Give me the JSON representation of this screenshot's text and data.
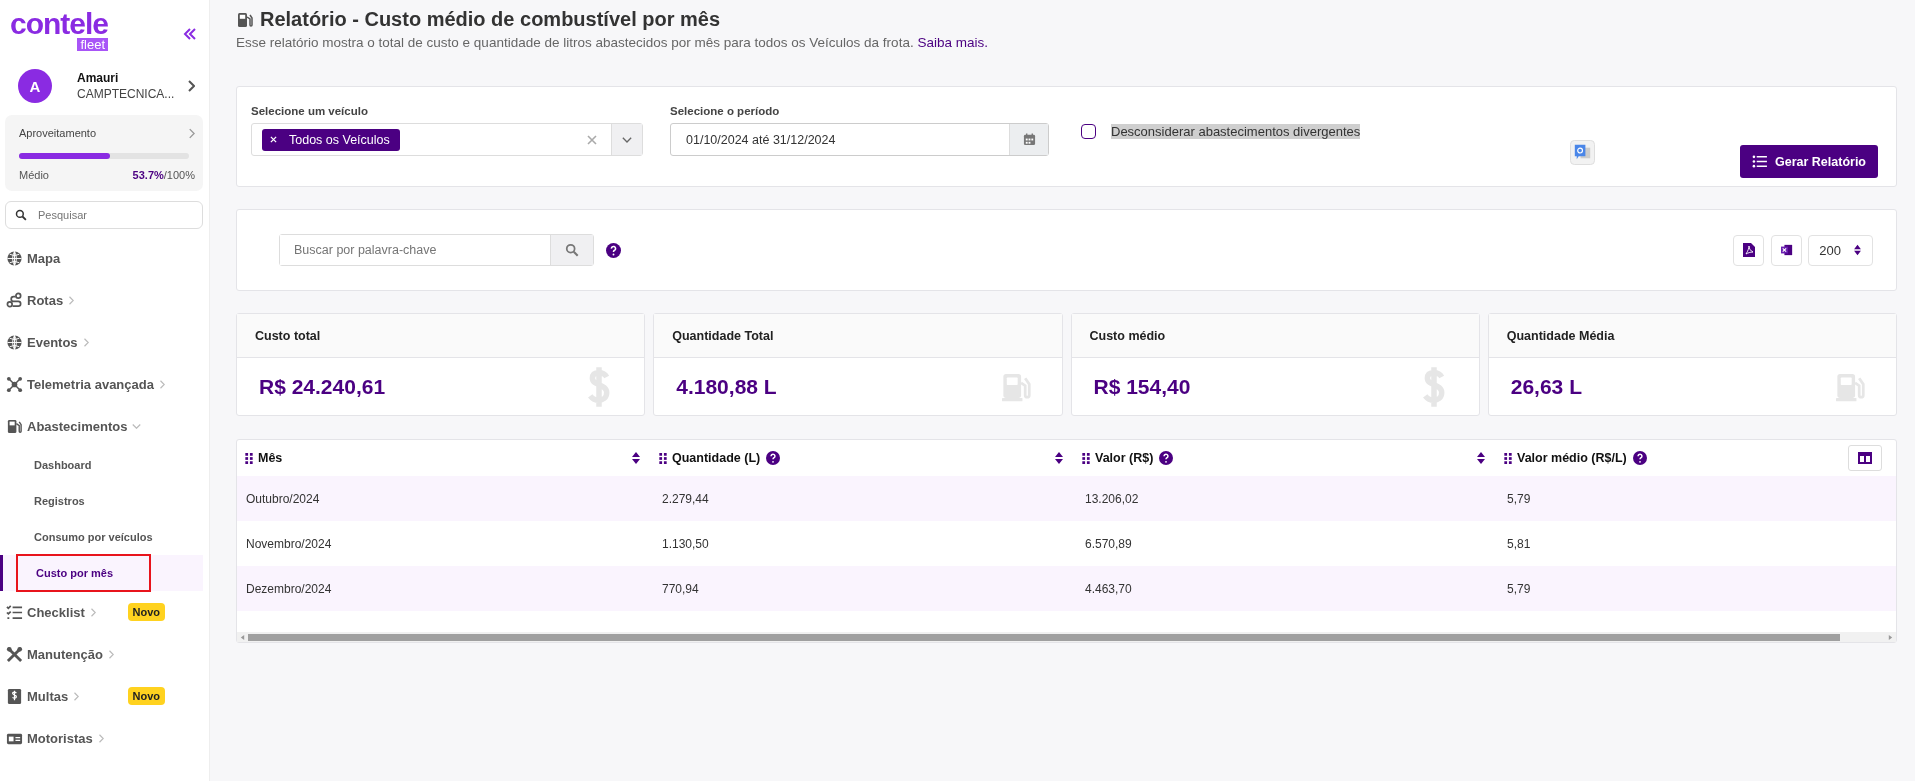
{
  "sidebar": {
    "logo": {
      "text": "contele",
      "badge": "fleet"
    },
    "user": {
      "initial": "A",
      "name": "Amauri",
      "company": "CAMPTECNICA..."
    },
    "usage": {
      "label": "Aproveitamento",
      "level": 0.537,
      "rating": "Médio",
      "value": "53.7%",
      "total": "/100%"
    },
    "search": {
      "placeholder": "Pesquisar"
    },
    "items": [
      {
        "label": "Mapa"
      },
      {
        "label": "Rotas",
        "expanded": false
      },
      {
        "label": "Eventos",
        "expanded": false
      },
      {
        "label": "Telemetria avançada",
        "expanded": false
      },
      {
        "label": "Abastecimentos",
        "expanded": true,
        "children": [
          {
            "label": "Dashboard",
            "selected": false,
            "highlighted": false
          },
          {
            "label": "Registros",
            "selected": false,
            "highlighted": false
          },
          {
            "label": "Consumo por veículos",
            "selected": false,
            "highlighted": false
          },
          {
            "label": "Custo por mês",
            "selected": true,
            "highlighted": true
          }
        ]
      },
      {
        "label": "Checklist",
        "expanded": false,
        "badge": "Novo"
      },
      {
        "label": "Manutenção",
        "expanded": false
      },
      {
        "label": "Multas",
        "expanded": false,
        "badge": "Novo"
      },
      {
        "label": "Motoristas",
        "expanded": false
      }
    ]
  },
  "header": {
    "title": "Relatório - Custo médio de combustível por mês",
    "description": "Esse relatório mostra o total de custo e quantidade de litros abastecidos por mês para todos os Veículos da frota.",
    "link": "Saiba mais."
  },
  "filters": {
    "vehicle": {
      "label": "Selecione um veículo",
      "chips": [
        "Todos os Veículos"
      ]
    },
    "period": {
      "label": "Selecione o período",
      "value": "01/10/2024 até 31/12/2024"
    },
    "ignore_divergent": {
      "label": "Desconsiderar abastecimentos divergentes",
      "checked": false
    },
    "button": "Gerar Relatório"
  },
  "toolbar": {
    "search_placeholder": "Buscar por palavra-chave",
    "page_size": "200"
  },
  "stats": [
    {
      "title": "Custo total",
      "value": "R$ 24.240,61",
      "kind": "money"
    },
    {
      "title": "Quantidade Total",
      "value": "4.180,88 L",
      "kind": "fuel"
    },
    {
      "title": "Custo médio",
      "value": "R$ 154,40",
      "kind": "money"
    },
    {
      "title": "Quantidade Média",
      "value": "26,63 L",
      "kind": "fuel"
    }
  ],
  "table": {
    "columns": [
      {
        "label": "Mês",
        "help": false
      },
      {
        "label": "Quantidade (L)",
        "help": true
      },
      {
        "label": "Valor (R$)",
        "help": true
      },
      {
        "label": "Valor médio (R$/L)",
        "help": true
      }
    ],
    "rows": [
      [
        "Outubro/2024",
        "2.279,44",
        "13.206,02",
        "5,79"
      ],
      [
        "Novembro/2024",
        "1.130,50",
        "6.570,89",
        "5,81"
      ],
      [
        "Dezembro/2024",
        "770,94",
        "4.463,70",
        "5,79"
      ]
    ]
  }
}
